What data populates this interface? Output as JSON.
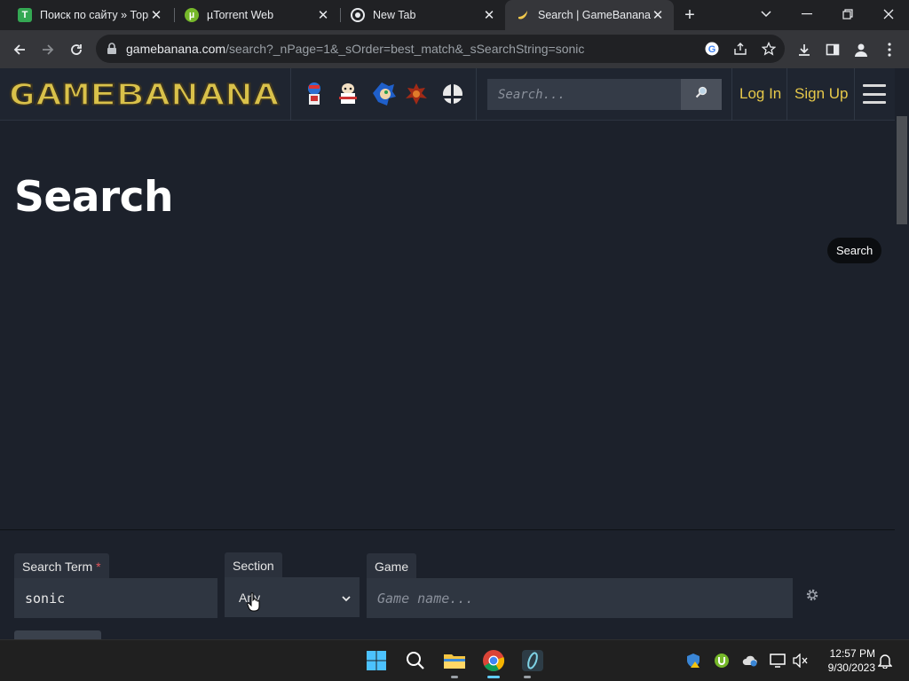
{
  "browser": {
    "tabs": [
      {
        "title": "Поиск по сайту » Торр",
        "favicon_letter": "T",
        "favicon_color": "#34a853"
      },
      {
        "title": "µTorrent Web",
        "favicon_letter": "µ",
        "favicon_color": "#76b82a"
      },
      {
        "title": "New Tab",
        "favicon_letter": "",
        "favicon_color": "#e8eaed"
      },
      {
        "title": "Search | GameBanana",
        "favicon_letter": "",
        "favicon_color": "#f2c94c"
      }
    ],
    "url_host": "gamebanana.com",
    "url_path": "/search?_nPage=1&_sOrder=best_match&_sSearchString=sonic"
  },
  "site": {
    "logo_text": "GAMEBANANA",
    "search_placeholder": "Search...",
    "login_label": "Log In",
    "signup_label": "Sign Up",
    "accent_color": "#e6c84a"
  },
  "page": {
    "title": "Search",
    "search_pill_label": "Search"
  },
  "form": {
    "search_term_label": "Search Term",
    "required_mark": "*",
    "search_term_value": "sonic",
    "section_label": "Section",
    "section_value": "Any",
    "game_label": "Game",
    "game_placeholder": "Game name..."
  },
  "taskbar": {
    "time": "12:57 PM",
    "date": "9/30/2023"
  }
}
